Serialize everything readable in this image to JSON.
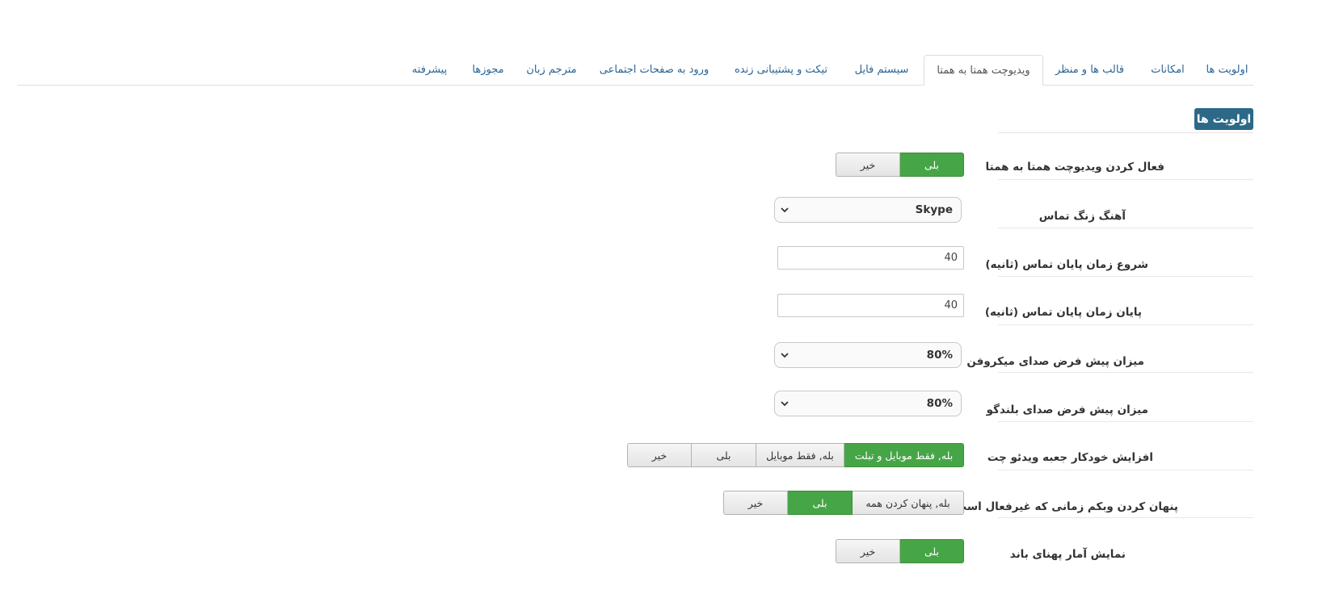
{
  "tabs": [
    {
      "label": "اولویت ها",
      "active": false
    },
    {
      "label": "امکانات",
      "active": false
    },
    {
      "label": "قالب ها و منظر",
      "active": false
    },
    {
      "label": "ویدیوچت همتا به همتا",
      "active": true
    },
    {
      "label": "سیستم فایل",
      "active": false
    },
    {
      "label": "تیکت و پشتیبانی زنده",
      "active": false
    },
    {
      "label": "ورود به صفحات اجتماعی",
      "active": false
    },
    {
      "label": "مترجم زبان",
      "active": false
    },
    {
      "label": "مجوزها",
      "active": false
    },
    {
      "label": "پیشرفته",
      "active": false
    }
  ],
  "section_title": "اولویت ها",
  "accent_color": "#2d6987",
  "active_button_color": "#46a546",
  "rows": {
    "enable_p2p": {
      "label": "فعال کردن ویدیوچت همتا به همتا",
      "options": [
        "بلی",
        "خیر"
      ],
      "selected": "بلی"
    },
    "ringtone": {
      "label": "آهنگ زنگ تماس",
      "value": "Skype",
      "icon": "chevron-down-icon"
    },
    "call_end_start": {
      "label": "شروع زمان پایان تماس (ثانیه)",
      "value": "40"
    },
    "call_end_finish": {
      "label": "پایان زمان پایان تماس (ثانیه)",
      "value": "40"
    },
    "mic_volume": {
      "label": "میزان پیش فرض صدای میکروفن",
      "value": "80%",
      "icon": "chevron-down-icon"
    },
    "speaker_volume": {
      "label": "میزان پیش فرض صدای بلندگو",
      "value": "80%",
      "icon": "chevron-down-icon"
    },
    "auto_expand": {
      "label": "افزایش خودکار جعبه ویدئو چت",
      "options": [
        "بله, فقط موبایل و تبلت",
        "بله, فقط موبایل",
        "بلی",
        "خیر"
      ],
      "selected": "بله, فقط موبایل و تبلت"
    },
    "hide_webcam": {
      "label": "پنهان کردن وبکم زمانی که غیرفعال است",
      "options": [
        "بله, پنهان کردن همه",
        "بلی",
        "خیر"
      ],
      "selected": "بلی"
    },
    "bandwidth_stats": {
      "label": "نمایش آمار پهنای باند",
      "options": [
        "بلی",
        "خیر"
      ],
      "selected": "بلی"
    }
  }
}
